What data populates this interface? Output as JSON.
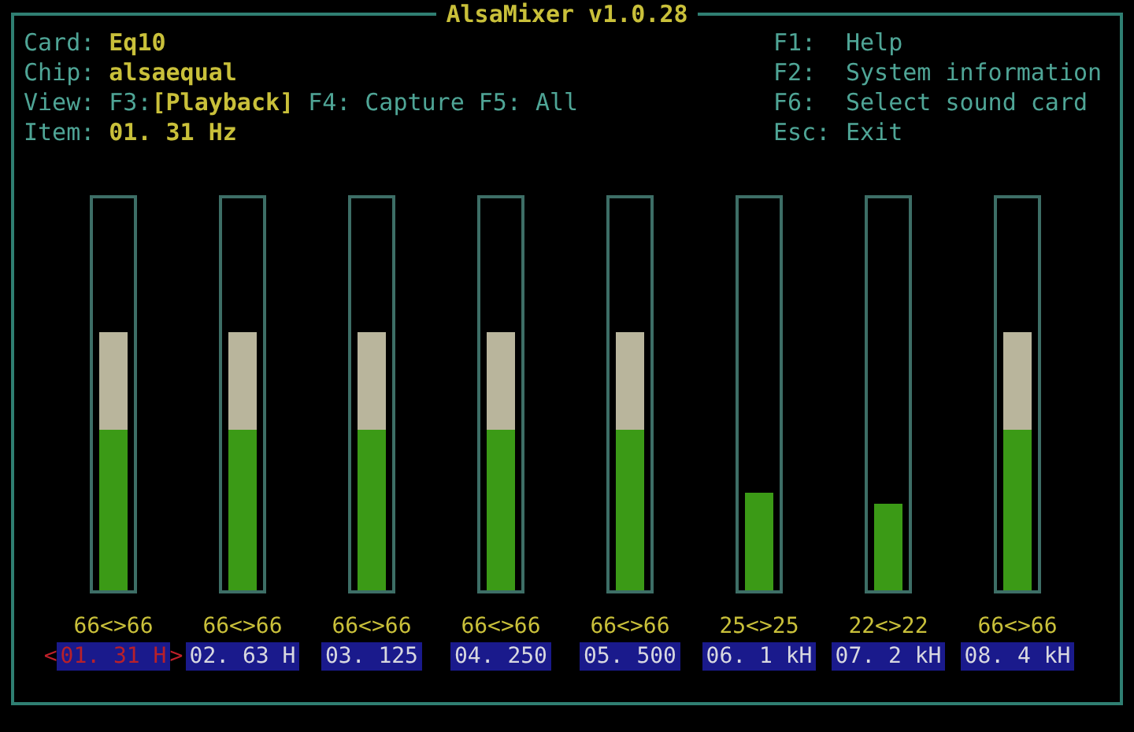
{
  "window": {
    "title": "AlsaMixer v1.0.28"
  },
  "info": [
    {
      "label": "Card:",
      "value": "Eq10"
    },
    {
      "label": "Chip:",
      "value": "alsaequal"
    }
  ],
  "view": {
    "label": "View:",
    "modes": [
      {
        "key": "F3:",
        "name": "[Playback]",
        "selected": true
      },
      {
        "key": "F4:",
        "name": "Capture",
        "selected": false
      },
      {
        "key": "F5:",
        "name": "All",
        "selected": false
      }
    ]
  },
  "item": {
    "label": "Item:",
    "value": "01. 31 Hz"
  },
  "help": [
    {
      "key": "F1:",
      "action": "Help"
    },
    {
      "key": "F2:",
      "action": "System information"
    },
    {
      "key": "F6:",
      "action": "Select sound card"
    },
    {
      "key": "Esc:",
      "action": "Exit"
    }
  ],
  "selection_arrows": {
    "left": "<",
    "right": ">"
  },
  "channels": [
    {
      "name": "01. 31 H",
      "level": 0.66,
      "reading": "66<>66",
      "selected": true
    },
    {
      "name": "02. 63 H",
      "level": 0.66,
      "reading": "66<>66",
      "selected": false
    },
    {
      "name": "03. 125",
      "level": 0.66,
      "reading": "66<>66",
      "selected": false
    },
    {
      "name": "04. 250",
      "level": 0.66,
      "reading": "66<>66",
      "selected": false
    },
    {
      "name": "05. 500",
      "level": 0.66,
      "reading": "66<>66",
      "selected": false
    },
    {
      "name": "06. 1 kH",
      "level": 0.25,
      "reading": "25<>25",
      "selected": false
    },
    {
      "name": "07. 2 kH",
      "level": 0.22,
      "reading": "22<>22",
      "selected": false
    },
    {
      "name": "08. 4 kH",
      "level": 0.66,
      "reading": "66<>66",
      "selected": false
    }
  ]
}
